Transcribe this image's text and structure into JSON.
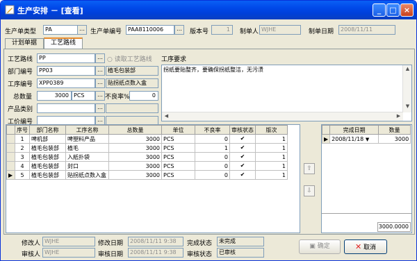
{
  "window": {
    "title": "生产安排 － [查看]",
    "minimize": "_",
    "maximize": "□",
    "close": "×"
  },
  "header": {
    "order_type_label": "生产单类型",
    "order_type_value": "PA",
    "order_no_label": "生产单编号",
    "order_no_value": "PAA8110006",
    "version_label": "版本号",
    "version_value": "1",
    "creator_label": "制单人",
    "creator_value": "WJHE",
    "create_date_label": "制单日期",
    "create_date_value": "2008/11/11"
  },
  "tabs": [
    "计划单据",
    "工艺路线"
  ],
  "form": {
    "route_label": "工艺路线",
    "route_value": "PP",
    "read_route_label": "读取工艺路线",
    "dept_label": "部门编号",
    "dept_value": "PP03",
    "dept_name": "植毛包装部",
    "proc_label": "工序编号",
    "proc_value": "XPP0389",
    "proc_name": "贴拐纸点数入盒",
    "qty_label": "总数量",
    "qty_value": "3000",
    "unit_value": "PCS",
    "defect_label": "不良率%",
    "defect_value": "0",
    "category_label": "产品类别",
    "price_label": "工价编号",
    "requirement_label": "工序要求",
    "requirement_value": "拐纸要贴整齐，要确保拐纸整洁，无污渍"
  },
  "grid": {
    "headers": [
      "序号",
      "部门名称",
      "工序名称",
      "总数量",
      "单位",
      "不良率",
      "审核状态",
      "版次"
    ],
    "rows": [
      [
        "1",
        "啤机部",
        "啤塑料产品",
        "3000",
        "PCS",
        "0",
        "✔",
        "1"
      ],
      [
        "2",
        "植毛包装部",
        "植毛",
        "3000",
        "PCS",
        "1",
        "✔",
        "1"
      ],
      [
        "3",
        "植毛包装部",
        "入紙扑袋",
        "3000",
        "PCS",
        "0",
        "✔",
        "1"
      ],
      [
        "4",
        "植毛包装部",
        "封口",
        "3000",
        "PCS",
        "0",
        "✔",
        "1"
      ],
      [
        "5",
        "植毛包装部",
        "贴拐纸点数入盒",
        "3000",
        "PCS",
        "0",
        "✔",
        "1"
      ]
    ]
  },
  "sidegrid": {
    "headers": [
      "完成日期",
      "数量"
    ],
    "rows": [
      [
        "2008/11/18",
        "3000"
      ]
    ],
    "total": "3000.0000"
  },
  "footer": {
    "modifier_label": "修改人",
    "modifier_value": "WJHE",
    "modify_date_label": "修改日期",
    "modify_date_value": "2008/11/11 9:38",
    "complete_label": "完成状态",
    "complete_value": "未完成",
    "auditor_label": "审核人",
    "auditor_value": "WJHE",
    "audit_date_label": "审核日期",
    "audit_date_value": "2008/11/11 9:38",
    "audit_status_label": "审核状态",
    "audit_status_value": "已审核",
    "ok_label": "确定",
    "cancel_label": "取消"
  },
  "colors": {
    "titlebar": "#0a5ff5",
    "panel": "#ece9d8",
    "cancel_icon": "#e02020"
  }
}
